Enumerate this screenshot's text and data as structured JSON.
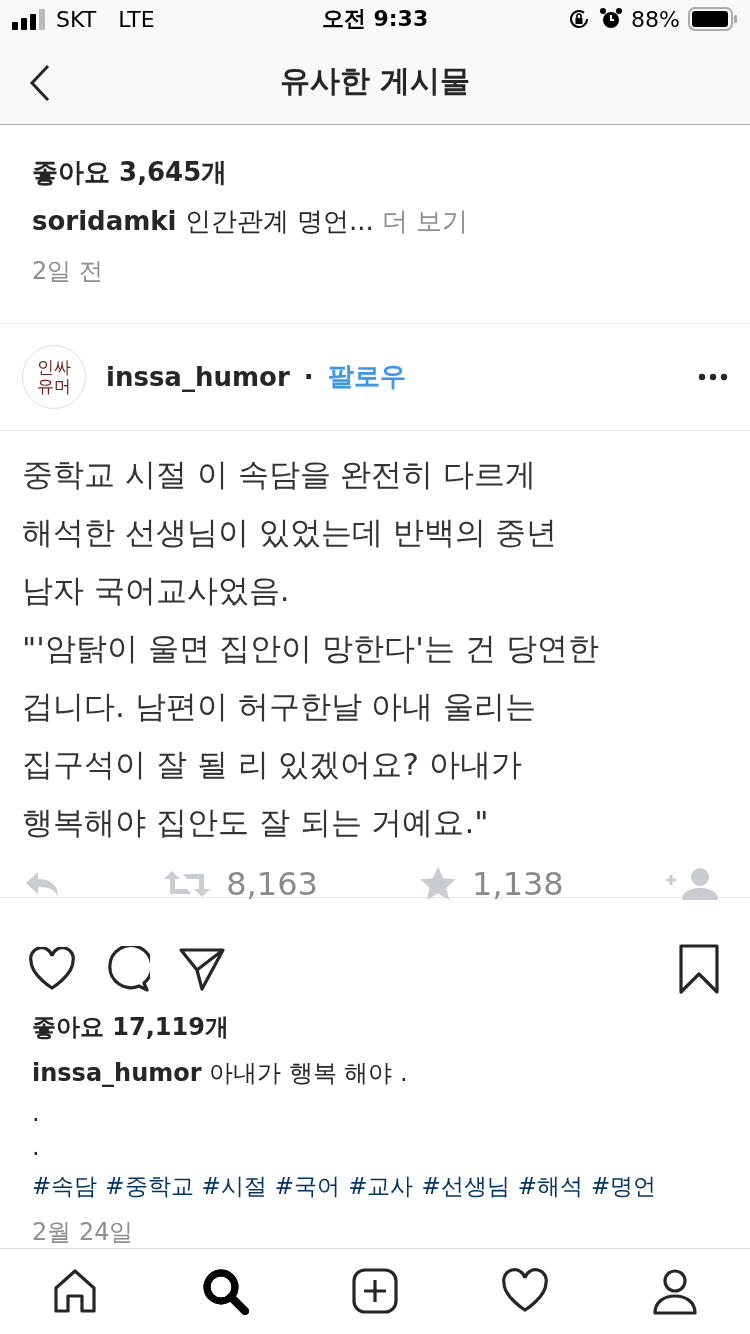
{
  "status_bar": {
    "carrier": "SKT",
    "network": "LTE",
    "time": "오전 9:33",
    "battery": "88%"
  },
  "nav": {
    "title": "유사한 게시물"
  },
  "previous_post": {
    "likes": "좋아요 3,645개",
    "username": "soridamki",
    "caption": "인간관계 명언...",
    "more": "더 보기",
    "time": "2일 전"
  },
  "post": {
    "avatar_text": [
      "인싸",
      "유머"
    ],
    "username": "inssa_humor",
    "separator": "·",
    "follow": "팔로우",
    "tweet": {
      "lines": [
        "중학교 시절 이 속담을 완전히 다르게",
        "해석한 선생님이 있었는데 반백의 중년",
        "남자 국어교사었음.",
        "\"'암탉이 울면 집안이 망한다'는 건 당연한",
        "겁니다. 남편이 허구한날 아내 울리는",
        "집구석이 잘 될 리 있겠어요? 아내가",
        "행복해야 집안도 잘 되는 거예요.\""
      ],
      "retweets": "8,163",
      "favorites": "1,138"
    },
    "likes": "좋아요 17,119개",
    "caption_username": "inssa_humor",
    "caption": "아내가 행복 해야 .",
    "caption_lines": [
      ".",
      "."
    ],
    "hashtags": [
      "#속담",
      "#중학교",
      "#시절",
      "#국어",
      "#교사",
      "#선생님",
      "#해석",
      "#명언"
    ],
    "date": "2월 24일"
  },
  "tab_bar": [
    {
      "kind": "home",
      "selected": false
    },
    {
      "kind": "search",
      "selected": true
    },
    {
      "kind": "add",
      "selected": false
    },
    {
      "kind": "heart",
      "selected": false
    },
    {
      "kind": "profile",
      "selected": false
    }
  ]
}
